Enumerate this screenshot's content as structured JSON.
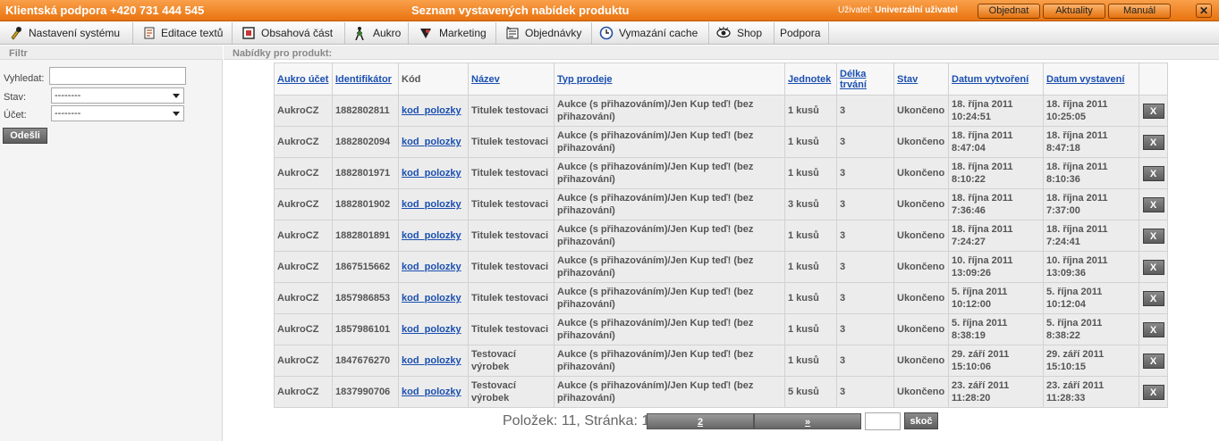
{
  "topbar": {
    "support": "Klientská podpora +420 731 444 545",
    "title": "Seznam vystavených nabídek produktu",
    "user_label": "Uživatel:",
    "user_name": "Univerzální uživatel",
    "buttons": [
      "Objednat",
      "Aktuality",
      "Manuál"
    ],
    "close": "✕"
  },
  "menu": [
    {
      "label": "Nastavení systému",
      "icon": "settings-icon"
    },
    {
      "label": "Editace textů",
      "icon": "text-edit-icon"
    },
    {
      "label": "Obsahová část",
      "icon": "content-icon"
    },
    {
      "label": "Aukro",
      "icon": "aukro-icon"
    },
    {
      "label": "Marketing",
      "icon": "marketing-icon"
    },
    {
      "label": "Objednávky",
      "icon": "orders-icon"
    },
    {
      "label": "Vymazání cache",
      "icon": "clock-icon"
    },
    {
      "label": "Shop",
      "icon": "eye-icon"
    },
    {
      "label": "Podpora",
      "icon": ""
    }
  ],
  "filter": {
    "heading": "Filtr",
    "search_label": "Vyhledat:",
    "search_value": "",
    "state_label": "Stav:",
    "state_value": "--------",
    "account_label": "Účet:",
    "account_value": "--------",
    "submit": "Odešli"
  },
  "content_heading": "Nabídky pro produkt:",
  "table": {
    "headers": [
      "Aukro účet",
      "Identifikátor",
      "Kód",
      "Název",
      "Typ prodeje",
      "Jednotek",
      "Délka trvání",
      "Stav",
      "Datum vytvoření",
      "Datum vystavení"
    ],
    "rows": [
      {
        "account": "AukroCZ",
        "id": "1882802811",
        "code": "kod_polozky",
        "name": "Titulek testovaci",
        "type": "Aukce (s přihazováním)/Jen Kup teď! (bez přihazování)",
        "units": "1 kusů",
        "duration": "3",
        "state": "Ukončeno",
        "created": "18. října 2011 10:24:51",
        "listed": "18. října 2011 10:25:05",
        "remove": "X"
      },
      {
        "account": "AukroCZ",
        "id": "1882802094",
        "code": "kod_polozky",
        "name": "Titulek testovaci",
        "type": "Aukce (s přihazováním)/Jen Kup teď! (bez přihazování)",
        "units": "1 kusů",
        "duration": "3",
        "state": "Ukončeno",
        "created": "18. října 2011 8:47:04",
        "listed": "18. října 2011 8:47:18",
        "remove": "X"
      },
      {
        "account": "AukroCZ",
        "id": "1882801971",
        "code": "kod_polozky",
        "name": "Titulek testovaci",
        "type": "Aukce (s přihazováním)/Jen Kup teď! (bez přihazování)",
        "units": "1 kusů",
        "duration": "3",
        "state": "Ukončeno",
        "created": "18. října 2011 8:10:22",
        "listed": "18. října 2011 8:10:36",
        "remove": "X"
      },
      {
        "account": "AukroCZ",
        "id": "1882801902",
        "code": "kod_polozky",
        "name": "Titulek testovaci",
        "type": "Aukce (s přihazováním)/Jen Kup teď! (bez přihazování)",
        "units": "3 kusů",
        "duration": "3",
        "state": "Ukončeno",
        "created": "18. října 2011 7:36:46",
        "listed": "18. října 2011 7:37:00",
        "remove": "X"
      },
      {
        "account": "AukroCZ",
        "id": "1882801891",
        "code": "kod_polozky",
        "name": "Titulek testovaci",
        "type": "Aukce (s přihazováním)/Jen Kup teď! (bez přihazování)",
        "units": "1 kusů",
        "duration": "3",
        "state": "Ukončeno",
        "created": "18. října 2011 7:24:27",
        "listed": "18. října 2011 7:24:41",
        "remove": "X"
      },
      {
        "account": "AukroCZ",
        "id": "1867515662",
        "code": "kod_polozky",
        "name": "Titulek testovaci",
        "type": "Aukce (s přihazováním)/Jen Kup teď! (bez přihazování)",
        "units": "1 kusů",
        "duration": "3",
        "state": "Ukončeno",
        "created": "10. října 2011 13:09:26",
        "listed": "10. října 2011 13:09:36",
        "remove": "X"
      },
      {
        "account": "AukroCZ",
        "id": "1857986853",
        "code": "kod_polozky",
        "name": "Titulek testovaci",
        "type": "Aukce (s přihazováním)/Jen Kup teď! (bez přihazování)",
        "units": "1 kusů",
        "duration": "3",
        "state": "Ukončeno",
        "created": "5. října 2011 10:12:00",
        "listed": "5. října 2011 10:12:04",
        "remove": "X"
      },
      {
        "account": "AukroCZ",
        "id": "1857986101",
        "code": "kod_polozky",
        "name": "Titulek testovaci",
        "type": "Aukce (s přihazováním)/Jen Kup teď! (bez přihazování)",
        "units": "1 kusů",
        "duration": "3",
        "state": "Ukončeno",
        "created": "5. října 2011 8:38:19",
        "listed": "5. října 2011 8:38:22",
        "remove": "X"
      },
      {
        "account": "AukroCZ",
        "id": "1847676270",
        "code": "kod_polozky",
        "name": "Testovací výrobek",
        "type": "Aukce (s přihazováním)/Jen Kup teď! (bez přihazování)",
        "units": "1 kusů",
        "duration": "3",
        "state": "Ukončeno",
        "created": "29. září 2011 15:10:06",
        "listed": "29. září 2011 15:10:15",
        "remove": "X"
      },
      {
        "account": "AukroCZ",
        "id": "1837990706",
        "code": "kod_polozky",
        "name": "Testovací výrobek",
        "type": "Aukce (s přihazováním)/Jen Kup teď! (bez přihazování)",
        "units": "5 kusů",
        "duration": "3",
        "state": "Ukončeno",
        "created": "23. září 2011 11:28:20",
        "listed": "23. září 2011 11:28:33",
        "remove": "X"
      }
    ]
  },
  "pager": {
    "summary": "Položek: 11, Stránka: 1",
    "next_page": "2",
    "next_arrow": "»",
    "jump_value": "",
    "jump_button": "skoč"
  }
}
